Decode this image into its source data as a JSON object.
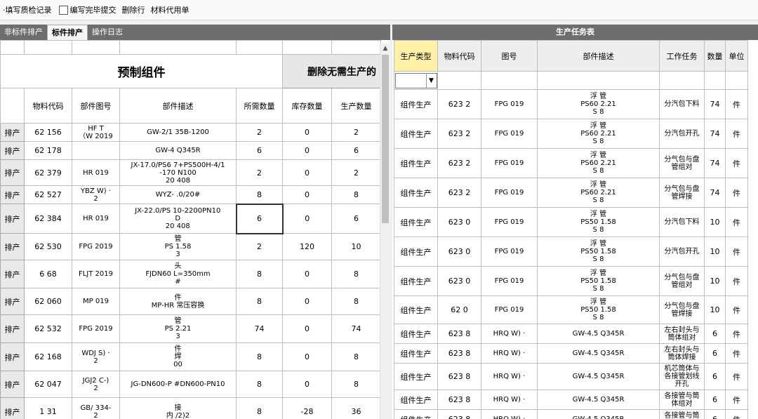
{
  "toolbar": {
    "items": [
      "填写质检记录",
      "编写完毕提交",
      "删除行",
      "材料代用单"
    ]
  },
  "left": {
    "tabs": [
      "非标件排产",
      "标件排产",
      "操作日志"
    ],
    "title": "预制组件",
    "delete_button": "删除无需生产的",
    "columns": [
      "物料代码",
      "部件图号",
      "部件描述",
      "所需数量",
      "库存数量",
      "生产数量"
    ],
    "row_button": "排产",
    "rows": [
      {
        "code": "62 156",
        "drawing": "HF T\n（W 2019",
        "desc": "GW-2/1 35B-1200",
        "need": "2",
        "stock": "0",
        "prod": "2"
      },
      {
        "code": "62 178",
        "drawing": "",
        "desc": "GW-4 Q345R",
        "need": "6",
        "stock": "0",
        "prod": "6"
      },
      {
        "code": "62 379",
        "drawing": "HR 019",
        "desc": "JX-17.0/PS6 7+PS500H-4/1\n-170 N100\n20 408",
        "need": "2",
        "stock": "0",
        "prod": "2"
      },
      {
        "code": "62 527",
        "drawing": "YBZ W) ·\n2",
        "desc": "WYZ- .0/20#",
        "need": "8",
        "stock": "0",
        "prod": "8"
      },
      {
        "code": "62 384",
        "drawing": "HR 019",
        "desc": "JX-22.0/PS 10-2200PN10\nD\n20 408",
        "need": "6",
        "stock": "0",
        "prod": "6"
      },
      {
        "code": "62 530",
        "drawing": "FPG 2019",
        "desc": "管\nPS 1.58\n3",
        "need": "2",
        "stock": "120",
        "prod": "10"
      },
      {
        "code": "6 68",
        "drawing": "FLJT 2019",
        "desc": "头\nFJDN60 L=350mm\n#",
        "need": "8",
        "stock": "0",
        "prod": "8"
      },
      {
        "code": "62 060",
        "drawing": "MP 019",
        "desc": "件\nMP-HR 常压容换",
        "need": "8",
        "stock": "0",
        "prod": "8"
      },
      {
        "code": "62 532",
        "drawing": "FPG 2019",
        "desc": "管\nPS 2.21\n3",
        "need": "74",
        "stock": "0",
        "prod": "74"
      },
      {
        "code": "62 168",
        "drawing": "WDJ S) ·\n2",
        "desc": "件\n焊\n00",
        "need": "8",
        "stock": "0",
        "prod": "8"
      },
      {
        "code": "62 047",
        "drawing": "JGJ2 C-)\n2",
        "desc": "JG-DN600-P #DN600-PN10",
        "need": "8",
        "stock": "0",
        "prod": "8"
      },
      {
        "code": "1 31",
        "drawing": "GB/ 334-\n2",
        "desc": "接\n内 /2)2",
        "need": "8",
        "stock": "-28",
        "prod": "36"
      }
    ]
  },
  "right": {
    "title": "生产任务表",
    "columns": [
      "生产类型",
      "物料代码",
      "图号",
      "部件描述",
      "工作任务",
      "数量",
      "单位"
    ],
    "rows": [
      {
        "type": "组件生产",
        "code": "623 2",
        "drawing": "FPG 019",
        "desc": "浮 管\nPS60 2.21\nS 8",
        "task": "分汽包下料",
        "qty": "74",
        "unit": "件"
      },
      {
        "type": "组件生产",
        "code": "623 2",
        "drawing": "FPG 019",
        "desc": "浮 管\nPS60 2.21\nS 8",
        "task": "分汽包开孔",
        "qty": "74",
        "unit": "件"
      },
      {
        "type": "组件生产",
        "code": "623 2",
        "drawing": "FPG 019",
        "desc": "浮 管\nPS60 2.21\nS 8",
        "task": "分气包与盘\n管组对",
        "qty": "74",
        "unit": "件"
      },
      {
        "type": "组件生产",
        "code": "623 2",
        "drawing": "FPG 019",
        "desc": "浮 管\nPS60 2.21\nS 8",
        "task": "分气包与盘\n管焊接",
        "qty": "74",
        "unit": "件"
      },
      {
        "type": "组件生产",
        "code": "623 0",
        "drawing": "FPG 019",
        "desc": "浮 管\nPS50 1.58\nS 8",
        "task": "分汽包下料",
        "qty": "10",
        "unit": "件"
      },
      {
        "type": "组件生产",
        "code": "623 0",
        "drawing": "FPG 019",
        "desc": "浮 管\nPS50 1.58\nS 8",
        "task": "分汽包开孔",
        "qty": "10",
        "unit": "件"
      },
      {
        "type": "组件生产",
        "code": "623 0",
        "drawing": "FPG 019",
        "desc": "浮 管\nPS50 1.58\nS 8",
        "task": "分气包与盘\n管组对",
        "qty": "10",
        "unit": "件"
      },
      {
        "type": "组件生产",
        "code": "62 0",
        "drawing": "FPG 019",
        "desc": "浮 管\nPS50 1.58\nS 8",
        "task": "分气包与盘\n管焊接",
        "qty": "10",
        "unit": "件"
      },
      {
        "type": "组件生产",
        "code": "623 8",
        "drawing": "HRQ W) ·",
        "desc": "GW-4.5 Q345R",
        "task": "左右封头与\n筒体组对",
        "qty": "6",
        "unit": "件"
      },
      {
        "type": "组件生产",
        "code": "623 8",
        "drawing": "HRQ W) ·",
        "desc": "GW-4.5 Q345R",
        "task": "左右封头与\n筒体焊接",
        "qty": "6",
        "unit": "件"
      },
      {
        "type": "组件生产",
        "code": "623 8",
        "drawing": "HRQ W) ·",
        "desc": "GW-4.5 Q345R",
        "task": "机芯筒体与\n各接管划线\n开孔",
        "qty": "6",
        "unit": "件"
      },
      {
        "type": "组件生产",
        "code": "623 8",
        "drawing": "HRQ W) ·",
        "desc": "GW-4.5 Q345R",
        "task": "各接管与筒\n体组对",
        "qty": "6",
        "unit": "件"
      },
      {
        "type": "组件生产",
        "code": "623 8",
        "drawing": "HRQ W) ·",
        "desc": "GW-4.5 Q345R",
        "task": "各接管与筒\n体焊接",
        "qty": "6",
        "unit": "件"
      }
    ]
  }
}
